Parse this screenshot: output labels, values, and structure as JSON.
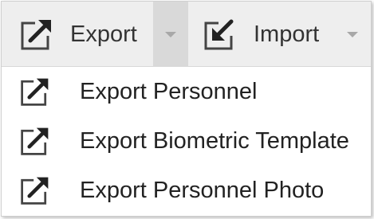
{
  "toolbar": {
    "export_label": "Export",
    "export_icon": "export-icon",
    "import_label": "Import",
    "import_icon": "import-icon"
  },
  "menu": {
    "items": [
      {
        "label": "Export Personnel",
        "icon": "export-icon"
      },
      {
        "label": "Export Biometric Template",
        "icon": "export-icon"
      },
      {
        "label": "Export Personnel Photo",
        "icon": "export-icon"
      }
    ]
  },
  "colors": {
    "toolbar_bg": "#eeeeee",
    "caret_active_bg": "#d9d9d9",
    "text": "#333333"
  }
}
